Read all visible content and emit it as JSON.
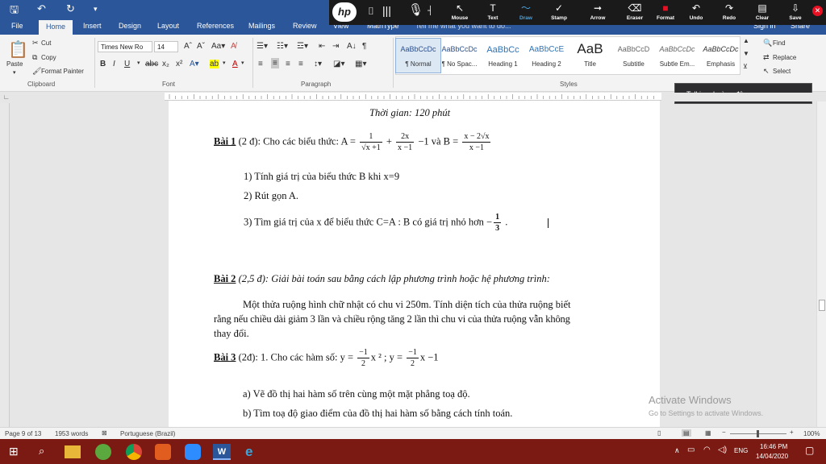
{
  "quick_access": {
    "save_icon": "save-icon",
    "undo_icon": "undo-icon",
    "redo_icon": "redo-icon"
  },
  "tabs": [
    {
      "label": "File"
    },
    {
      "label": "Home"
    },
    {
      "label": "Insert"
    },
    {
      "label": "Design"
    },
    {
      "label": "Layout"
    },
    {
      "label": "References"
    },
    {
      "label": "Mailings"
    },
    {
      "label": "Review"
    },
    {
      "label": "View"
    },
    {
      "label": "MathType"
    }
  ],
  "tell_me": "Tell me what you want to do...",
  "sign_in": "Sign in",
  "share": "Share",
  "hp_toolbar": {
    "tools": [
      {
        "label": "Mouse",
        "glyph": "↖"
      },
      {
        "label": "Text",
        "glyph": "T"
      },
      {
        "label": "Draw",
        "glyph": "〜"
      },
      {
        "label": "Stamp",
        "glyph": "✓"
      },
      {
        "label": "Arrow",
        "glyph": "➞"
      },
      {
        "label": "Eraser",
        "glyph": "⌫"
      },
      {
        "label": "Format",
        "glyph": "■"
      },
      {
        "label": "Undo",
        "glyph": "↶"
      },
      {
        "label": "Redo",
        "glyph": "↷"
      },
      {
        "label": "Clear",
        "glyph": "▤"
      },
      {
        "label": "Save",
        "glyph": "⇩"
      }
    ],
    "accent": "#e81123",
    "active_color": "#4aa3df"
  },
  "ribbon": {
    "clipboard": {
      "paste": "Paste",
      "cut": "Cut",
      "copy": "Copy",
      "format_painter": "Format Painter",
      "group": "Clipboard"
    },
    "font": {
      "name": "Times New Ro",
      "size": "14",
      "group": "Font"
    },
    "paragraph": {
      "group": "Paragraph"
    },
    "styles": {
      "group": "Styles",
      "items": [
        {
          "preview": "AaBbCcDc",
          "name": "¶ Normal"
        },
        {
          "preview": "AaBbCcDc",
          "name": "¶ No Spac..."
        },
        {
          "preview": "AaBbCc",
          "name": "Heading 1"
        },
        {
          "preview": "AaBbCcE",
          "name": "Heading 2"
        },
        {
          "preview": "AaB",
          "name": "Title"
        },
        {
          "preview": "AaBbCcD",
          "name": "Subtitle"
        },
        {
          "preview": "AaBbCcDc",
          "name": "Subtle Em..."
        },
        {
          "preview": "AaBbCcDc",
          "name": "Emphasis"
        }
      ]
    },
    "editing": {
      "find": "Find",
      "replace": "Replace",
      "select": "Select"
    }
  },
  "talking": "Talking: hoàng đông",
  "document": {
    "time": "Thời gian: 120 phút",
    "bai1_head": "Bài 1",
    "bai1_pts": " (2 đ):  Cho các biểu thức:  A = ",
    "a_f1_n": "1",
    "a_f1_d": "√x +1",
    "plus": " + ",
    "a_f2_n": "2x",
    "a_f2_d": "x −1",
    "a_tail": " −1  và B = ",
    "b_n": "x − 2√x",
    "b_d": "x −1",
    "q1": "1)  Tính giá trị của biểu thức B khi x=9",
    "q2": "2)  Rút gọn A.",
    "q3": "3) Tìm  giá trị của x để biểu thức C=A : B có giá trị nhỏ hơn  −",
    "q3_n": "1",
    "q3_d": "3",
    "q3_tail": " .",
    "bai2_head": "Bài 2",
    "bai2_pts": " (2,5 đ): ",
    "bai2_task": "Giải bài toán sau bằng cách lập phương trình hoặc hệ phương trình:",
    "p1": "Một thửa ruộng hình chữ nhật có chu vi 250m. Tính diện tích của thửa ruộng biết",
    "p2": "rằng nếu chiều dài giảm 3 lần và chiều rộng tăng 2 lần thì chu vi của thửa ruộng vẫn không",
    "p3": "thay đổi.",
    "bai3_head": "Bài 3",
    "bai3_pts": " (2đ): 1. Cho các hàm số:  y = ",
    "f1_n": "−1",
    "f1_d": "2",
    "f1_tail": "x ² ; y = ",
    "f2_n": "−1",
    "f2_d": "2",
    "f2_tail": "x  −1",
    "qa": "a)  Vẽ đồ thị hai hàm số trên cùng một mặt phẳng toạ độ.",
    "qb": "b)  Tìm toạ độ giao điểm của đồ thị hai hàm số bằng cách tính toán."
  },
  "watermark": {
    "line1": "Activate Windows",
    "line2": "Go to Settings to activate Windows."
  },
  "status": {
    "page": "Page 9 of 13",
    "words": "1953 words",
    "language": "Portuguese (Brazil)",
    "zoom": "100%"
  },
  "taskbar": {
    "time": "16:46 PM",
    "date": "14/04/2020",
    "lang": "ENG"
  }
}
